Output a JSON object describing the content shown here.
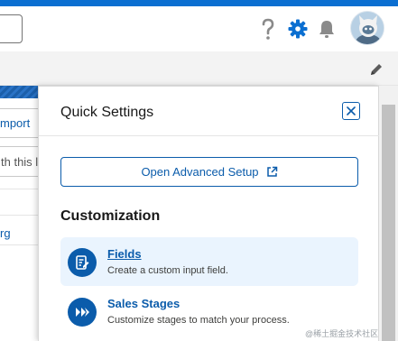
{
  "header": {
    "icons": [
      "help-icon",
      "gear-icon",
      "bell-icon",
      "avatar"
    ],
    "accent_color": "#0b6fd1"
  },
  "background_page": {
    "import_label": "mport",
    "search_placeholder": "th this li",
    "row_link": "rg"
  },
  "panel": {
    "title": "Quick Settings",
    "close_icon": "close-icon",
    "advanced_setup_label": "Open Advanced Setup",
    "advanced_setup_icon": "external-link-icon",
    "section_heading": "Customization",
    "items": [
      {
        "title": "Fields",
        "description": "Create a custom input field.",
        "icon": "fields-icon"
      },
      {
        "title": "Sales Stages",
        "description": "Customize stages to match your process.",
        "icon": "sales-stages-icon"
      }
    ],
    "accent_color": "#0b5cab"
  },
  "watermark": "@稀土掘金技术社区"
}
